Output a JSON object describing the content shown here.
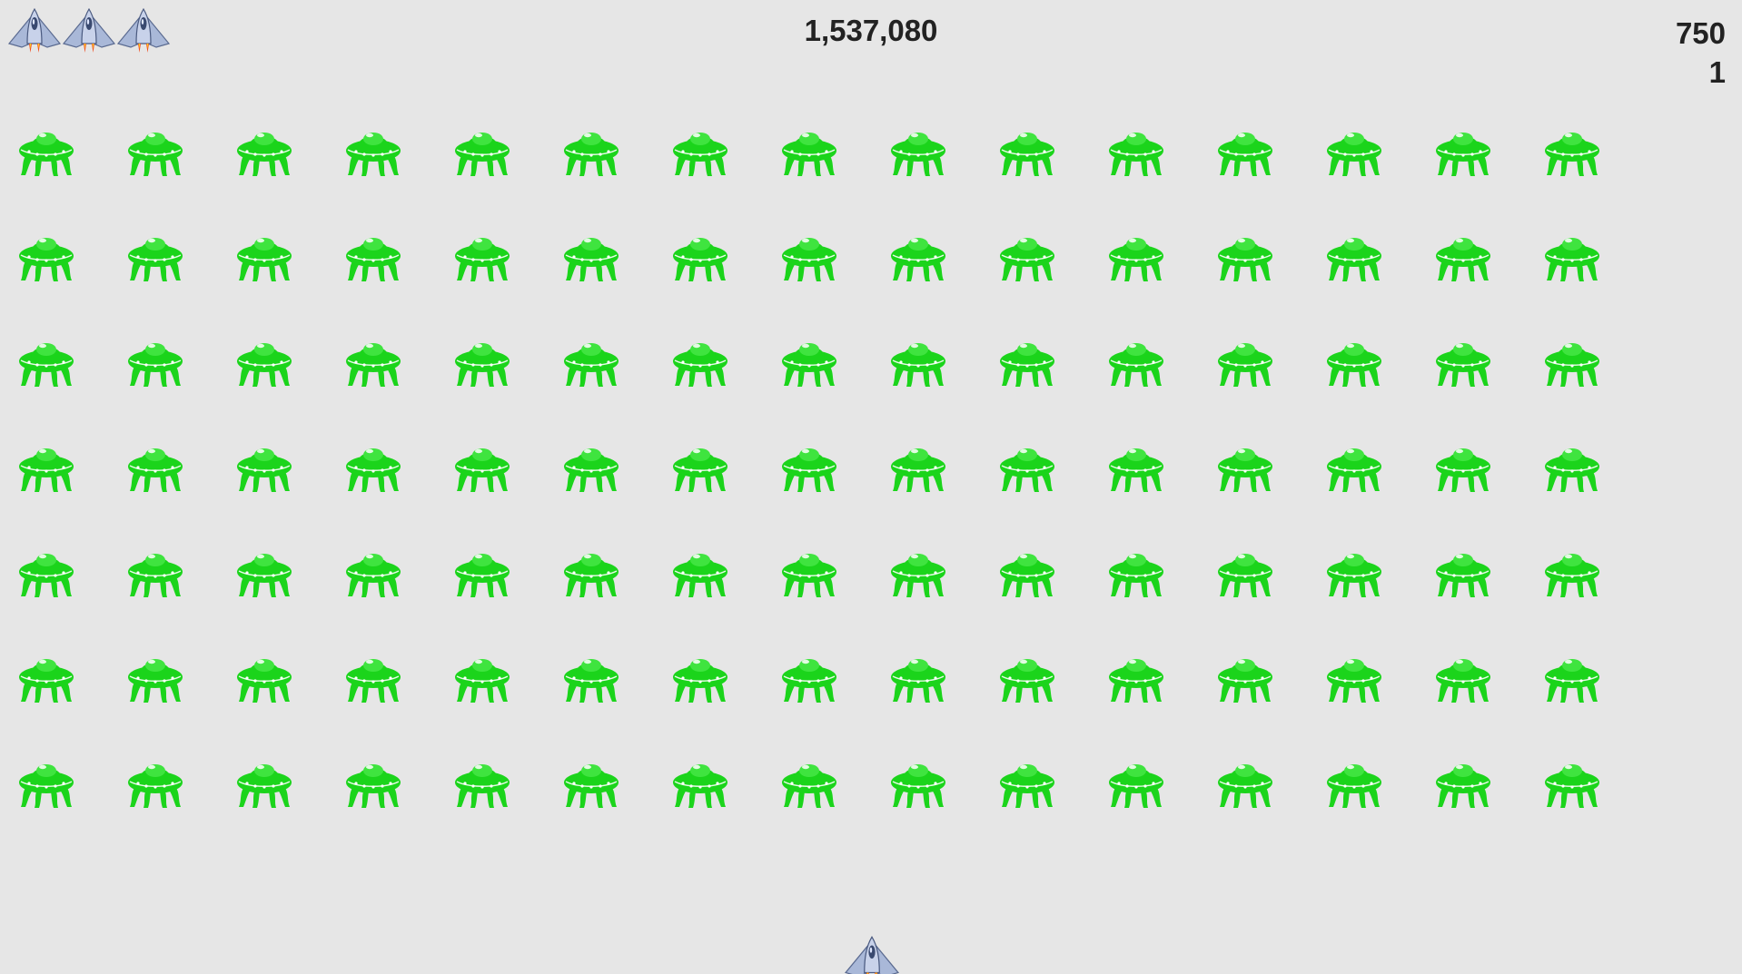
{
  "hud": {
    "score": "1,537,080",
    "stat_top": "750",
    "stat_bottom": "1",
    "lives": 3
  },
  "aliens": {
    "rows": 7,
    "cols": 15,
    "icon": "green-ufo-alien-icon",
    "color": "#1bd41b"
  },
  "player": {
    "icon": "player-spaceship-icon"
  },
  "colors": {
    "background": "#e6e6e6",
    "alien": "#1bd41b",
    "ship_body": "#8a9bbf",
    "flame": "#f24a1a"
  }
}
